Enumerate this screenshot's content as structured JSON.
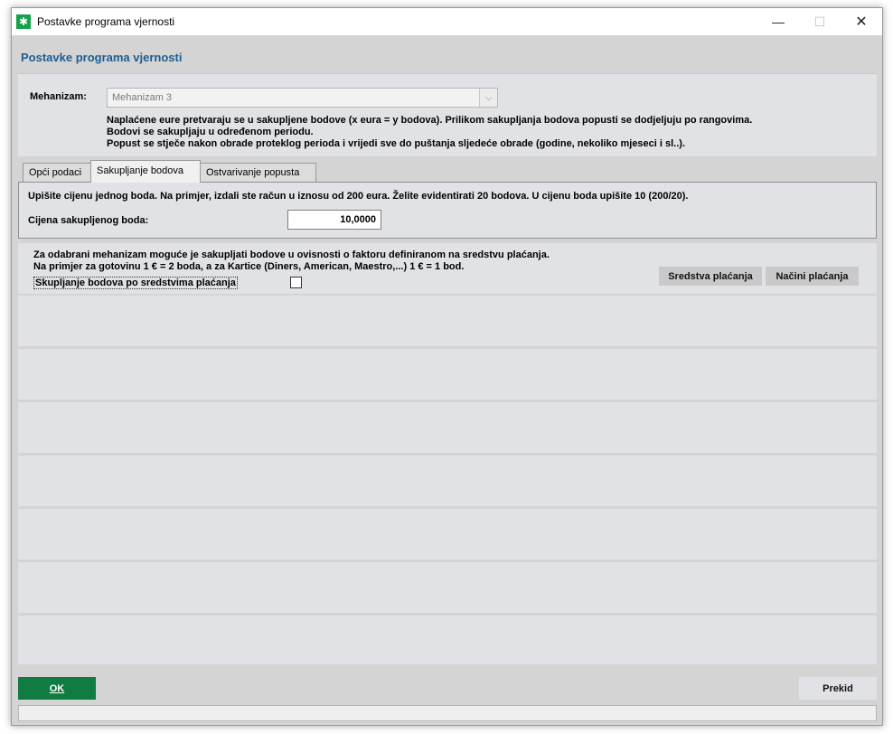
{
  "window": {
    "title": "Postavke programa vjernosti",
    "icon": "green-star-icon",
    "controls": {
      "minimize": "—",
      "maximize": "☐",
      "close": "✕"
    }
  },
  "header": {
    "title": "Postavke programa vjernosti"
  },
  "mechanism": {
    "label": "Mehanizam:",
    "selected": "Mehanizam 3",
    "description": [
      "Naplaćene eure pretvaraju se u sakupljene bodove (x eura = y bodova). Prilikom sakupljanja bodova popusti se dodjeljuju po rangovima.",
      "Bodovi se sakupljaju u određenom periodu.",
      "Popust se stječe nakon obrade proteklog perioda i vrijedi sve do puštanja sljedeće obrade (godine, nekoliko mjeseci i sl..)."
    ]
  },
  "tabs": [
    {
      "label": "Opći podaci",
      "active": false
    },
    {
      "label": "Sakupljanje bodova",
      "active": true
    },
    {
      "label": "Ostvarivanje popusta",
      "active": false
    }
  ],
  "points_panel": {
    "instructions": "Upišite cijenu jednog boda. Na primjer, izdali ste račun u iznosu od 200 eura. Želite evidentirati 20 bodova. U cijenu boda upišite 10 (200/20).",
    "price_label": "Cijena sakupljenog boda:",
    "price_value": "10,0000"
  },
  "payment_panel": {
    "lines": [
      "Za odabrani mehanizam moguće je sakupljati bodove u ovisnosti o faktoru definiranom na sredstvu plaćanja.",
      "Na primjer za gotovinu 1 € = 2 boda, a za Kartice (Diners, American, Maestro,...) 1 € = 1 bod."
    ],
    "checkbox_label": "Skupljanje bodova po sredstvima plaćanja",
    "checked": false,
    "btn_sredstva": "Sredstva plaćanja",
    "btn_nacini": "Načini plaćanja"
  },
  "footer": {
    "ok": "OK",
    "cancel": "Prekid"
  }
}
